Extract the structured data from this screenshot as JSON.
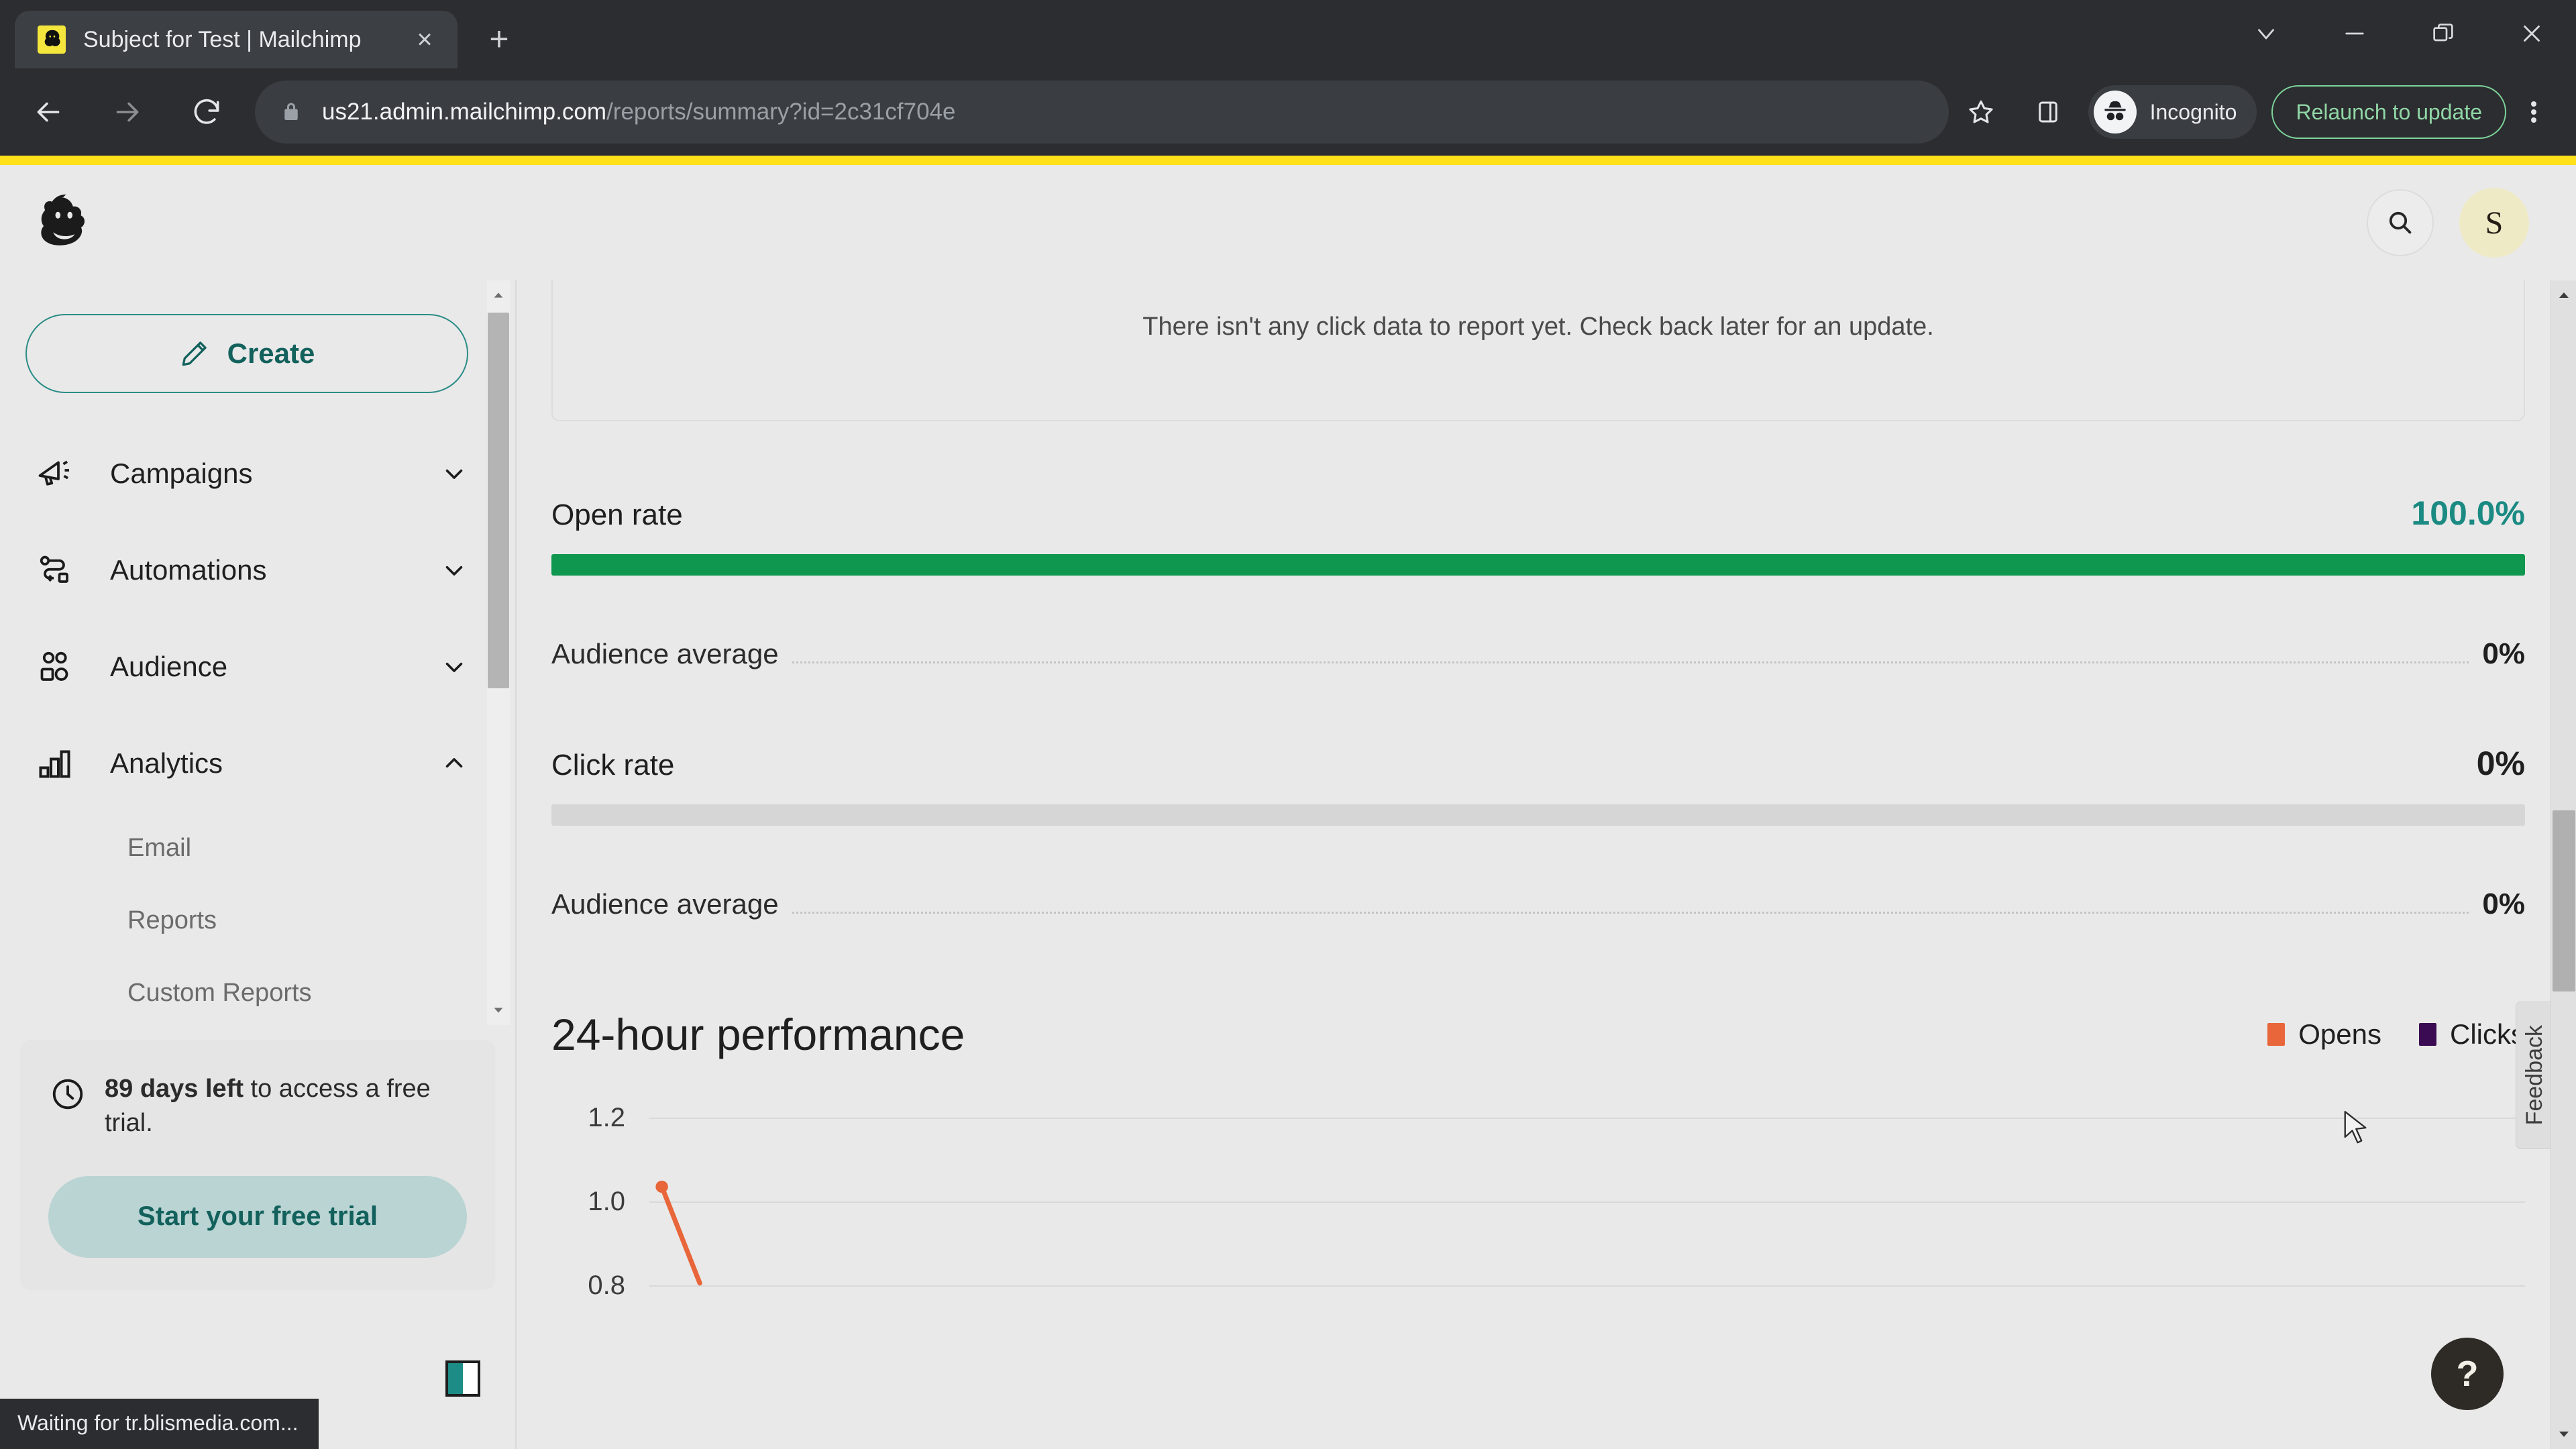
{
  "browser": {
    "tab": {
      "title": "Subject for Test | Mailchimp",
      "favicon": "mailchimp-freddie-icon",
      "close_label": "×"
    },
    "new_tab_label": "+",
    "window_controls": [
      {
        "name": "chevron-down-icon",
        "label": "⌄"
      },
      {
        "name": "minimize-icon",
        "label": "–"
      },
      {
        "name": "maximize-icon",
        "label": "❐"
      },
      {
        "name": "close-icon",
        "label": "×"
      }
    ],
    "nav": {
      "back": "back-arrow-icon",
      "forward": "forward-arrow-icon",
      "reload": "reload-icon"
    },
    "omnibox": {
      "lock": "lock-icon",
      "host": "us21.admin.mailchimp.com",
      "path": "/reports/summary?id=2c31cf704e",
      "full_url": "us21.admin.mailchimp.com/reports/summary?id=2c31cf704e"
    },
    "bookmark_icon": "star-icon",
    "side_panel_icon": "side-panel-icon",
    "incognito": {
      "label": "Incognito",
      "icon": "incognito-hat-glasses-icon"
    },
    "relaunch_button": "Relaunch to update",
    "menu_icon": "kebab-menu-icon",
    "status_text": "Waiting for tr.blismedia.com..."
  },
  "app_header": {
    "logo": "mailchimp-freddie-logo",
    "search_icon": "search-icon",
    "avatar_initial": "S"
  },
  "sidebar": {
    "create_button": "Create",
    "create_icon": "pencil-icon",
    "nav_items": [
      {
        "label": "Campaigns",
        "icon": "megaphone-icon",
        "expanded": false,
        "chevron": "chevron-down-icon"
      },
      {
        "label": "Automations",
        "icon": "automation-flow-icon",
        "expanded": false,
        "chevron": "chevron-down-icon"
      },
      {
        "label": "Audience",
        "icon": "people-icon",
        "expanded": false,
        "chevron": "chevron-down-icon"
      },
      {
        "label": "Analytics",
        "icon": "bar-chart-icon",
        "expanded": true,
        "chevron": "chevron-up-icon"
      }
    ],
    "sub_items": [
      {
        "label": "Email"
      },
      {
        "label": "Reports"
      },
      {
        "label": "Custom Reports"
      }
    ],
    "trial": {
      "icon": "clock-icon",
      "days_bold": "89 days left",
      "days_rest": " to access a free trial.",
      "button": "Start your free trial"
    },
    "footer_icon": "panel-toggle-icon"
  },
  "main": {
    "empty_click_data": "There isn't any click data to report yet. Check back later for an update.",
    "metrics": [
      {
        "label": "Open rate",
        "value": "100.0%",
        "value_accent": true,
        "bar_percent": 100,
        "bar_color": "#0f9750",
        "average_label": "Audience average",
        "average_value": "0%"
      },
      {
        "label": "Click rate",
        "value": "0%",
        "value_accent": false,
        "bar_percent": 0,
        "bar_color": "#0f9750",
        "average_label": "Audience average",
        "average_value": "0%"
      }
    ],
    "performance": {
      "title": "24-hour performance",
      "legend": [
        {
          "label": "Opens",
          "color": "#e8663a"
        },
        {
          "label": "Clicks",
          "color": "#3a0b52"
        }
      ]
    },
    "feedback_tab": "Feedback",
    "help_button": "?"
  },
  "chart_data": {
    "type": "line",
    "title": "24-hour performance",
    "xlabel": "",
    "ylabel": "",
    "ylim": [
      0.8,
      1.2
    ],
    "yticks": [
      1.2,
      1.0,
      0.8
    ],
    "ytick_labels": [
      "1.2",
      "1.0",
      "0.8"
    ],
    "grid": true,
    "legend_position": "top-right",
    "series": [
      {
        "name": "Opens",
        "color": "#e8663a",
        "x": [
          0,
          1
        ],
        "values": [
          1.0,
          0.77
        ]
      },
      {
        "name": "Clicks",
        "color": "#3a0b52",
        "x": [],
        "values": []
      }
    ],
    "note": "Chart is partially cut off at the bottom of the viewport; only the upper portion of the plot area from y=1.2 down to just past y=0.8 is visible."
  }
}
